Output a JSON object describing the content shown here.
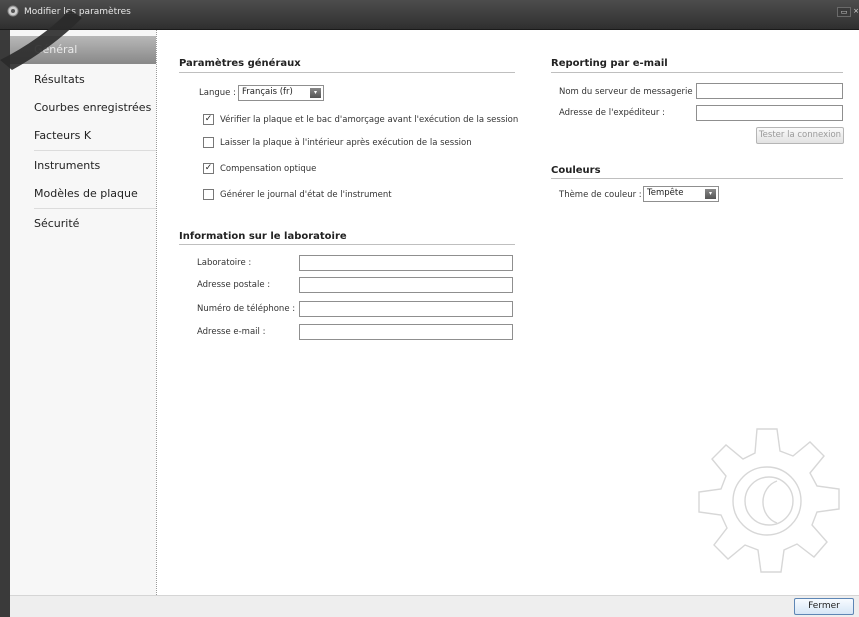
{
  "window": {
    "title": "Modifier les paramètres",
    "maximize_glyph": "▭",
    "close_glyph": "×"
  },
  "sidebar": {
    "items": [
      {
        "label": "Général",
        "active": true
      },
      {
        "label": "Résultats"
      },
      {
        "label": "Courbes enregistrées"
      },
      {
        "label": "Facteurs K"
      },
      {
        "label": "Instruments"
      },
      {
        "label": "Modèles de plaque"
      },
      {
        "label": "Sécurité"
      }
    ]
  },
  "general": {
    "title": "Paramètres généraux",
    "language_label": "Langue :",
    "language_value": "Français (fr)",
    "checkboxes": [
      {
        "label": "Vérifier la plaque et le bac d'amorçage avant l'exécution de la session",
        "checked": true,
        "mark": "✓"
      },
      {
        "label": "Laisser la plaque à l'intérieur après exécution de la session",
        "checked": false,
        "mark": ""
      },
      {
        "label": "Compensation optique",
        "checked": true,
        "mark": "✓"
      },
      {
        "label": "Générer le journal d'état de l'instrument",
        "checked": false,
        "mark": ""
      }
    ]
  },
  "lab": {
    "title": "Information sur le laboratoire",
    "fields": [
      {
        "label": "Laboratoire :",
        "value": ""
      },
      {
        "label": "Adresse postale :",
        "value": ""
      },
      {
        "label": "Numéro de téléphone :",
        "value": ""
      },
      {
        "label": "Adresse e-mail :",
        "value": ""
      }
    ]
  },
  "email": {
    "title": "Reporting par e-mail",
    "server_label": "Nom du serveur de messagerie :",
    "server_value": "",
    "sender_label": "Adresse de l'expéditeur :",
    "sender_value": "",
    "test_button": "Tester la connexion"
  },
  "colors": {
    "title": "Couleurs",
    "theme_label": "Thème de couleur :",
    "theme_value": "Tempête",
    "accent": "#5d86b5",
    "titlebar": "#3a3a3a"
  },
  "footer": {
    "close_button": "Fermer"
  },
  "icons": {
    "app": "settings-app-icon",
    "dropdown": "▾",
    "watermark": "gear-icon"
  }
}
